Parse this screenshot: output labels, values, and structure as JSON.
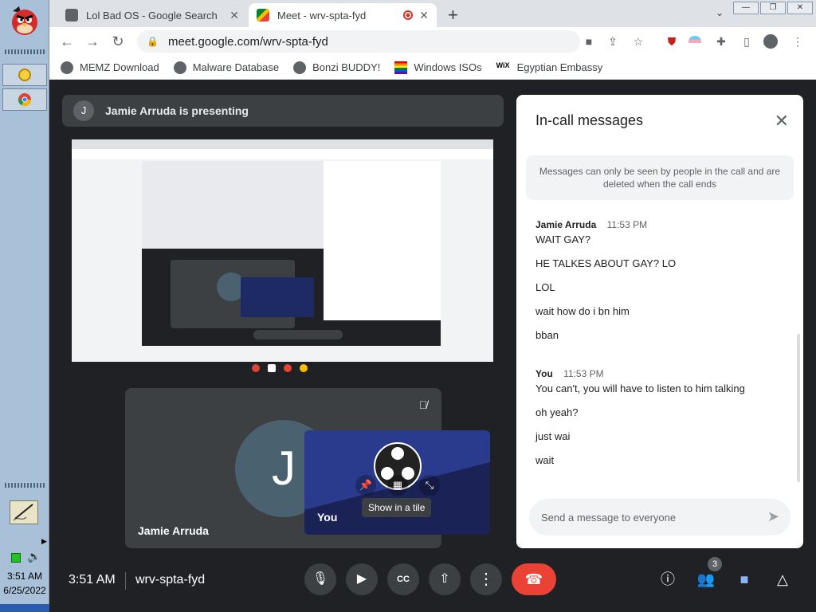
{
  "os": {
    "clock_time": "3:51 AM",
    "clock_date": "6/25/2022"
  },
  "browser": {
    "tabs": [
      {
        "title": "Lol Bad OS - Google Search",
        "active": false
      },
      {
        "title": "Meet - wrv-spta-fyd",
        "active": true
      }
    ],
    "url": "meet.google.com/wrv-spta-fyd",
    "bookmarks": [
      "MEMZ Download",
      "Malware Database",
      "Bonzi BUDDY!",
      "Windows ISOs",
      "Egyptian Embassy"
    ]
  },
  "meet": {
    "presenting_avatar": "J",
    "presenting_text": "Jamie Arruda is presenting",
    "jamie_tile": {
      "avatar": "J",
      "name": "Jamie Arruda"
    },
    "you_tile": {
      "name": "You"
    },
    "tooltip": "Show in a tile",
    "time": "3:51 AM",
    "meeting_code": "wrv-spta-fyd",
    "people_count": "3"
  },
  "chat": {
    "title": "In-call messages",
    "notice": "Messages can only be seen by people in the call and are deleted when the call ends",
    "groups": [
      {
        "sender": "Jamie Arruda",
        "time": "11:53 PM",
        "lines": [
          "WAIT GAY?",
          "HE TALKES ABOUT GAY? LO",
          "LOL",
          "wait how do i bn him",
          "bban"
        ]
      },
      {
        "sender": "You",
        "time": "11:53 PM",
        "lines": [
          "You can't, you will have to listen to him talking",
          "oh yeah?",
          "just wai",
          "wait"
        ]
      }
    ],
    "input_placeholder": "Send a message to everyone"
  },
  "colors": {
    "hangup": "#ea4335",
    "meet_bg": "#202124",
    "control_bg": "#3c4043",
    "accent_blue": "#8ab4f8"
  },
  "icons": {
    "mic": "mic-icon",
    "camera": "camera-icon",
    "captions": "captions-icon",
    "present": "present-icon",
    "more": "more-icon",
    "hangup": "hangup-icon",
    "info": "info-icon",
    "people": "people-icon",
    "chat": "chat-icon",
    "activities": "activities-icon"
  }
}
